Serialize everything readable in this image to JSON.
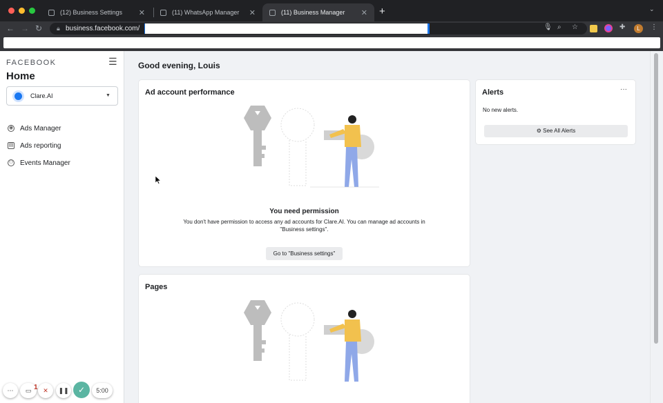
{
  "browser": {
    "tabs": [
      {
        "label": "(12) Business Settings",
        "active": false
      },
      {
        "label": "(11) WhatsApp Manager",
        "active": false
      },
      {
        "label": "(11) Business Manager",
        "active": true
      }
    ],
    "new_tab_icon": "plus-icon",
    "url": "business.facebook.com/",
    "avatar_initial": "L",
    "traffic_colors": [
      "#ff5f57",
      "#febc2e",
      "#28c840"
    ]
  },
  "sidebar": {
    "brand": "FACEBOOK",
    "title": "Home",
    "account": "Clare.AI",
    "nav": [
      {
        "label": "Ads Manager",
        "icon": "ads-manager-icon"
      },
      {
        "label": "Ads reporting",
        "icon": "ads-reporting-icon"
      },
      {
        "label": "Events Manager",
        "icon": "events-manager-icon"
      }
    ]
  },
  "main": {
    "greeting": "Good evening, Louis",
    "ad_performance": {
      "title": "Ad account performance",
      "permission_title": "You need permission",
      "permission_body": "You don't have permission to access any ad accounts for Clare.AI. You can manage ad accounts in \"Business settings\".",
      "button": "Go to \"Business settings\""
    },
    "pages": {
      "title": "Pages"
    },
    "alerts": {
      "title": "Alerts",
      "more": "···",
      "empty": "No new alerts.",
      "button": "See All Alerts"
    }
  },
  "recorder": {
    "count": "1",
    "timer": "5:00"
  },
  "colors": {
    "accent": "#1877f2",
    "page_bg": "#f0f2f5",
    "record_check": "#5bb5a2"
  }
}
